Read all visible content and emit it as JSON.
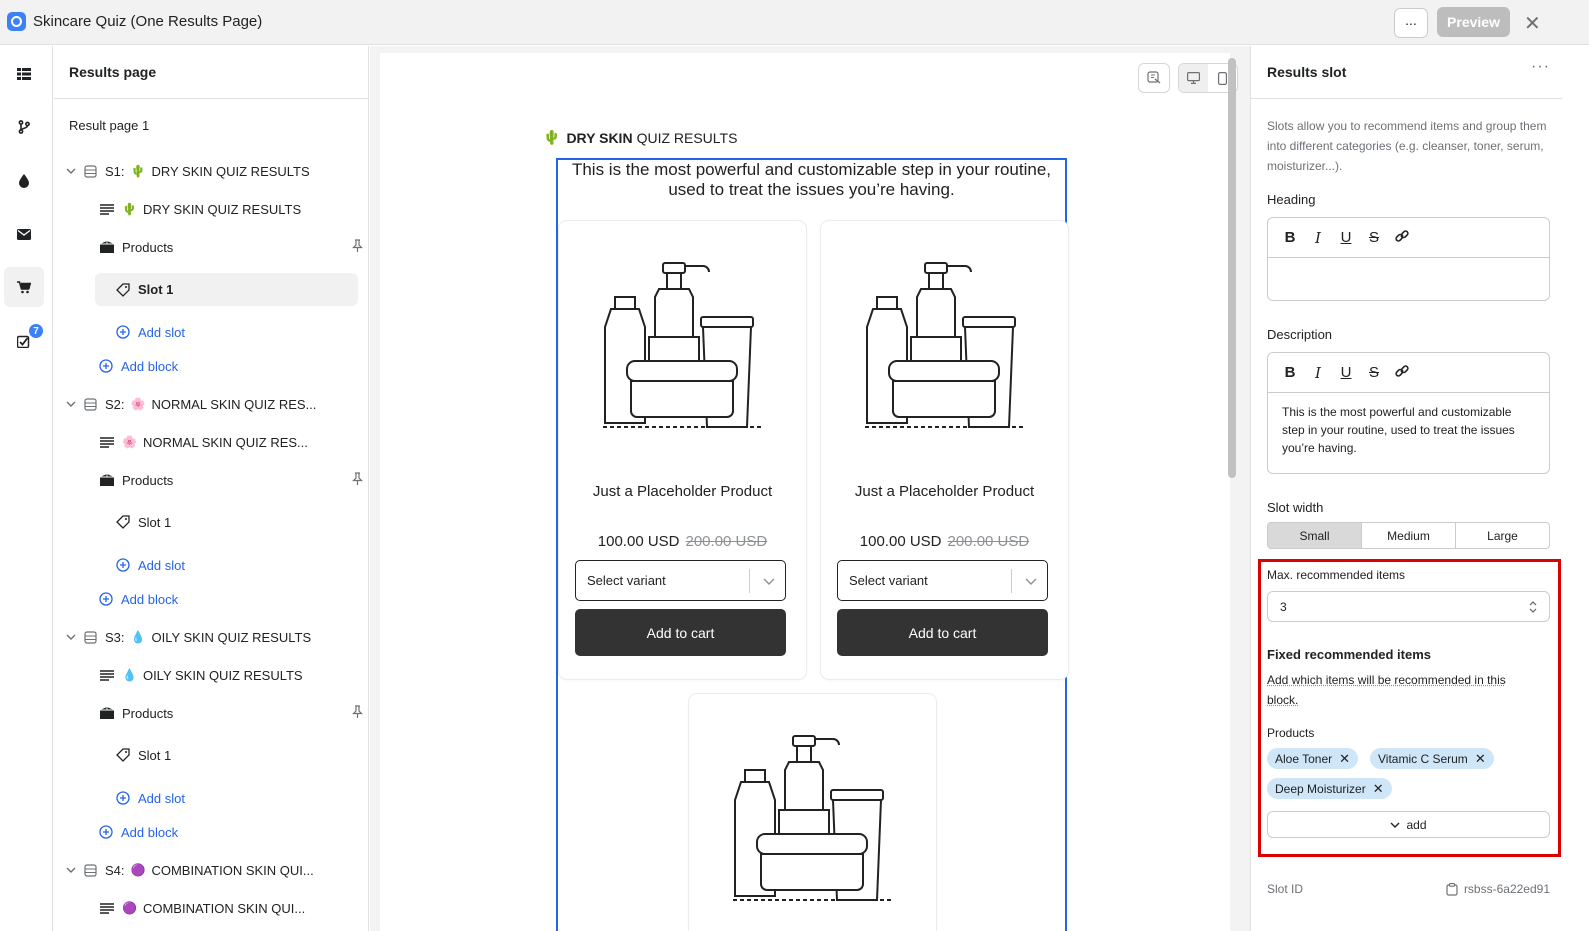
{
  "app": {
    "title": "Skincare Quiz (One Results Page)",
    "more_label": "...",
    "preview_label": "Preview",
    "close_symbol": "✕"
  },
  "rail": {
    "items": [
      {
        "icon": "grid-icon"
      },
      {
        "icon": "branch-icon"
      },
      {
        "icon": "droplet-icon"
      },
      {
        "icon": "mail-icon"
      },
      {
        "icon": "cart-icon",
        "active": true
      },
      {
        "icon": "checklist-icon",
        "badge": "7"
      }
    ]
  },
  "tree": {
    "header": "Results page",
    "page_label": "Result page 1",
    "sections": [
      {
        "label": "S1:",
        "emoji": "🌵",
        "title": "DRY SKIN QUIZ RESULTS",
        "text_block": "DRY SKIN QUIZ RESULTS",
        "products": "Products",
        "slot": "Slot 1",
        "add_slot": "Add slot",
        "add_block": "Add block"
      },
      {
        "label": "S2:",
        "emoji": "🌸",
        "title": "NORMAL SKIN QUIZ RES...",
        "text_block": "NORMAL SKIN QUIZ RES...",
        "products": "Products",
        "slot": "Slot 1",
        "add_slot": "Add slot",
        "add_block": "Add block"
      },
      {
        "label": "S3:",
        "emoji": "💧",
        "title": "OILY SKIN QUIZ RESULTS",
        "text_block": "OILY SKIN QUIZ RESULTS",
        "products": "Products",
        "slot": "Slot 1",
        "add_slot": "Add slot",
        "add_block": "Add block"
      },
      {
        "label": "S4:",
        "emoji": "🟣",
        "title": "COMBINATION SKIN QUI...",
        "text_block": "COMBINATION SKIN QUI..."
      }
    ]
  },
  "canvas": {
    "heading_emoji": "🌵",
    "heading_bold": "DRY SKIN",
    "heading_rest": "QUIZ RESULTS",
    "slot_description": "This is the most powerful and customizable step in your routine, used to treat the issues you’re having.",
    "products": [
      {
        "name": "Just a Placeholder Product",
        "price": "100.00 USD",
        "compare_price": "200.00 USD",
        "variant_placeholder": "Select variant",
        "cart_label": "Add to cart"
      },
      {
        "name": "Just a Placeholder Product",
        "price": "100.00 USD",
        "compare_price": "200.00 USD",
        "variant_placeholder": "Select variant",
        "cart_label": "Add to cart"
      },
      {
        "name": "",
        "price": "",
        "compare_price": "",
        "variant_placeholder": "",
        "cart_label": ""
      }
    ]
  },
  "settings": {
    "title": "Results slot",
    "more_label": "···",
    "intro": "Slots allow you to recommend items and group them into different categories (e.g. cleanser, toner, serum, moisturizer...).",
    "heading_label": "Heading",
    "heading_value": "",
    "description_label": "Description",
    "description_value": "This is the most powerful and customizable step in your routine, used to treat the issues you’re having.",
    "toolbar": {
      "bold": "B",
      "italic": "I",
      "underline": "U",
      "strike": "S"
    },
    "slot_width_label": "Slot width",
    "slot_width_options": [
      "Small",
      "Medium",
      "Large"
    ],
    "slot_width_selected": "Small",
    "max_items_label": "Max. recommended items",
    "max_items_value": "3",
    "fixed_title": "Fixed recommended items",
    "fixed_help": "Add which items will be recommended in this block.",
    "products_label": "Products",
    "chips": [
      "Aloe Toner",
      "Vitamic C Serum",
      "Deep Moisturizer"
    ],
    "chip_remove": "✕",
    "add_label": "add",
    "slot_id_label": "Slot ID",
    "slot_id_value": "rsbss-6a22ed91"
  },
  "colors": {
    "accent": "#2563eb",
    "highlight_frame": "#dc0000",
    "chip_bg": "#cfe6f8",
    "cart_button": "#333333"
  }
}
